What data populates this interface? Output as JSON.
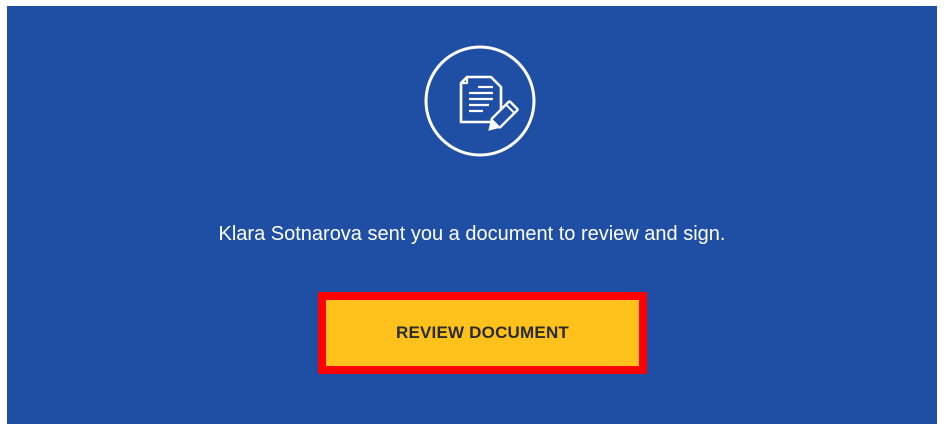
{
  "message": "Klara Sotnarova sent you a document to review and sign.",
  "cta": {
    "label": "REVIEW DOCUMENT"
  },
  "icon": "document-sign-icon",
  "colors": {
    "background": "#1f4fa5",
    "button": "#ffc21c",
    "highlight": "#ff0000",
    "text": "#ffffff"
  }
}
